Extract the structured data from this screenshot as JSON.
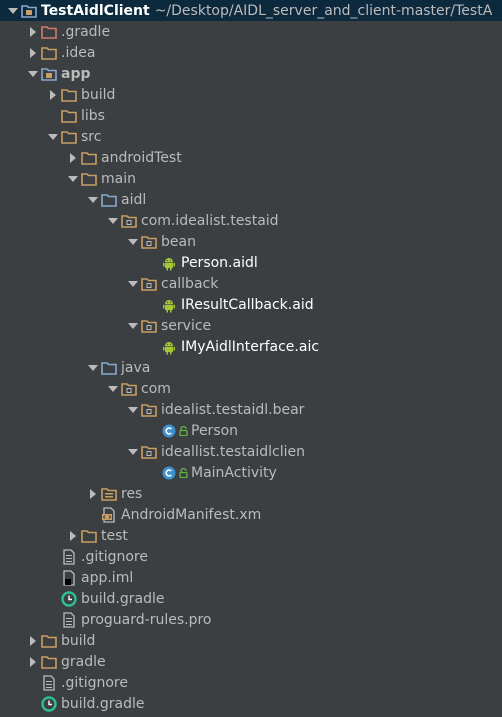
{
  "project": {
    "name": "TestAidlClient",
    "path": "~/Desktop/AIDL_server_and_client-master/TestA"
  },
  "colors": {
    "background": "#3c3f41",
    "selected_row": "#0d293e",
    "folder": "#c79e63",
    "source_folder": "#86a9cf",
    "excluded_folder": "#d27a6b",
    "android": "#a4c639",
    "class_icon": "#3c92d0",
    "gradle": "#2cc08e"
  },
  "tree": [
    {
      "label": "TestAidlClient",
      "extra": "~/Desktop/AIDL_server_and_client-master/TestA",
      "depth": 0,
      "arrow": "down",
      "icon": "module-folder-icon",
      "bold": true,
      "selected": true
    },
    {
      "label": ".gradle",
      "depth": 1,
      "arrow": "right",
      "icon": "excluded-folder-icon"
    },
    {
      "label": ".idea",
      "depth": 1,
      "arrow": "right",
      "icon": "folder-icon"
    },
    {
      "label": "app",
      "depth": 1,
      "arrow": "down",
      "icon": "module-folder-icon",
      "bold": true
    },
    {
      "label": "build",
      "depth": 2,
      "arrow": "right",
      "icon": "folder-icon"
    },
    {
      "label": "libs",
      "depth": 2,
      "arrow": "none",
      "icon": "folder-icon"
    },
    {
      "label": "src",
      "depth": 2,
      "arrow": "down",
      "icon": "folder-icon"
    },
    {
      "label": "androidTest",
      "depth": 3,
      "arrow": "right",
      "icon": "folder-icon"
    },
    {
      "label": "main",
      "depth": 3,
      "arrow": "down",
      "icon": "folder-icon"
    },
    {
      "label": "aidl",
      "depth": 4,
      "arrow": "down",
      "icon": "source-folder-icon"
    },
    {
      "label": "com.idealist.testaid",
      "depth": 5,
      "arrow": "down",
      "icon": "package-icon"
    },
    {
      "label": "bean",
      "depth": 6,
      "arrow": "down",
      "icon": "package-icon"
    },
    {
      "label": "Person.aidl",
      "depth": 7,
      "arrow": "none",
      "icon": "android-icon",
      "white": true
    },
    {
      "label": "callback",
      "depth": 6,
      "arrow": "down",
      "icon": "package-icon"
    },
    {
      "label": "IResultCallback.aid",
      "depth": 7,
      "arrow": "none",
      "icon": "android-icon",
      "white": true
    },
    {
      "label": "service",
      "depth": 6,
      "arrow": "down",
      "icon": "package-icon"
    },
    {
      "label": "IMyAidlInterface.aic",
      "depth": 7,
      "arrow": "none",
      "icon": "android-icon",
      "white": true
    },
    {
      "label": "java",
      "depth": 4,
      "arrow": "down",
      "icon": "source-folder-icon"
    },
    {
      "label": "com",
      "depth": 5,
      "arrow": "down",
      "icon": "package-icon"
    },
    {
      "label": "idealist.testaidl.bear",
      "depth": 6,
      "arrow": "down",
      "icon": "package-icon"
    },
    {
      "label": "Person",
      "depth": 7,
      "arrow": "none",
      "icon": "class-icon",
      "lock": true
    },
    {
      "label": "ideallist.testaidlclien",
      "depth": 6,
      "arrow": "down",
      "icon": "package-icon"
    },
    {
      "label": "MainActivity",
      "depth": 7,
      "arrow": "none",
      "icon": "class-icon",
      "lock": true
    },
    {
      "label": "res",
      "depth": 4,
      "arrow": "right",
      "icon": "resource-folder-icon"
    },
    {
      "label": "AndroidManifest.xm",
      "depth": 4,
      "arrow": "none",
      "icon": "xml-file-icon"
    },
    {
      "label": "test",
      "depth": 3,
      "arrow": "right",
      "icon": "folder-icon"
    },
    {
      "label": ".gitignore",
      "depth": 2,
      "arrow": "none",
      "icon": "text-file-icon"
    },
    {
      "label": "app.iml",
      "depth": 2,
      "arrow": "none",
      "icon": "iml-file-icon"
    },
    {
      "label": "build.gradle",
      "depth": 2,
      "arrow": "none",
      "icon": "gradle-icon"
    },
    {
      "label": "proguard-rules.pro",
      "depth": 2,
      "arrow": "none",
      "icon": "text-file-icon"
    },
    {
      "label": "build",
      "depth": 1,
      "arrow": "right",
      "icon": "folder-icon"
    },
    {
      "label": "gradle",
      "depth": 1,
      "arrow": "right",
      "icon": "folder-icon"
    },
    {
      "label": ".gitignore",
      "depth": 1,
      "arrow": "none",
      "icon": "text-file-icon"
    },
    {
      "label": "build.gradle",
      "depth": 1,
      "arrow": "none",
      "icon": "gradle-icon"
    }
  ]
}
